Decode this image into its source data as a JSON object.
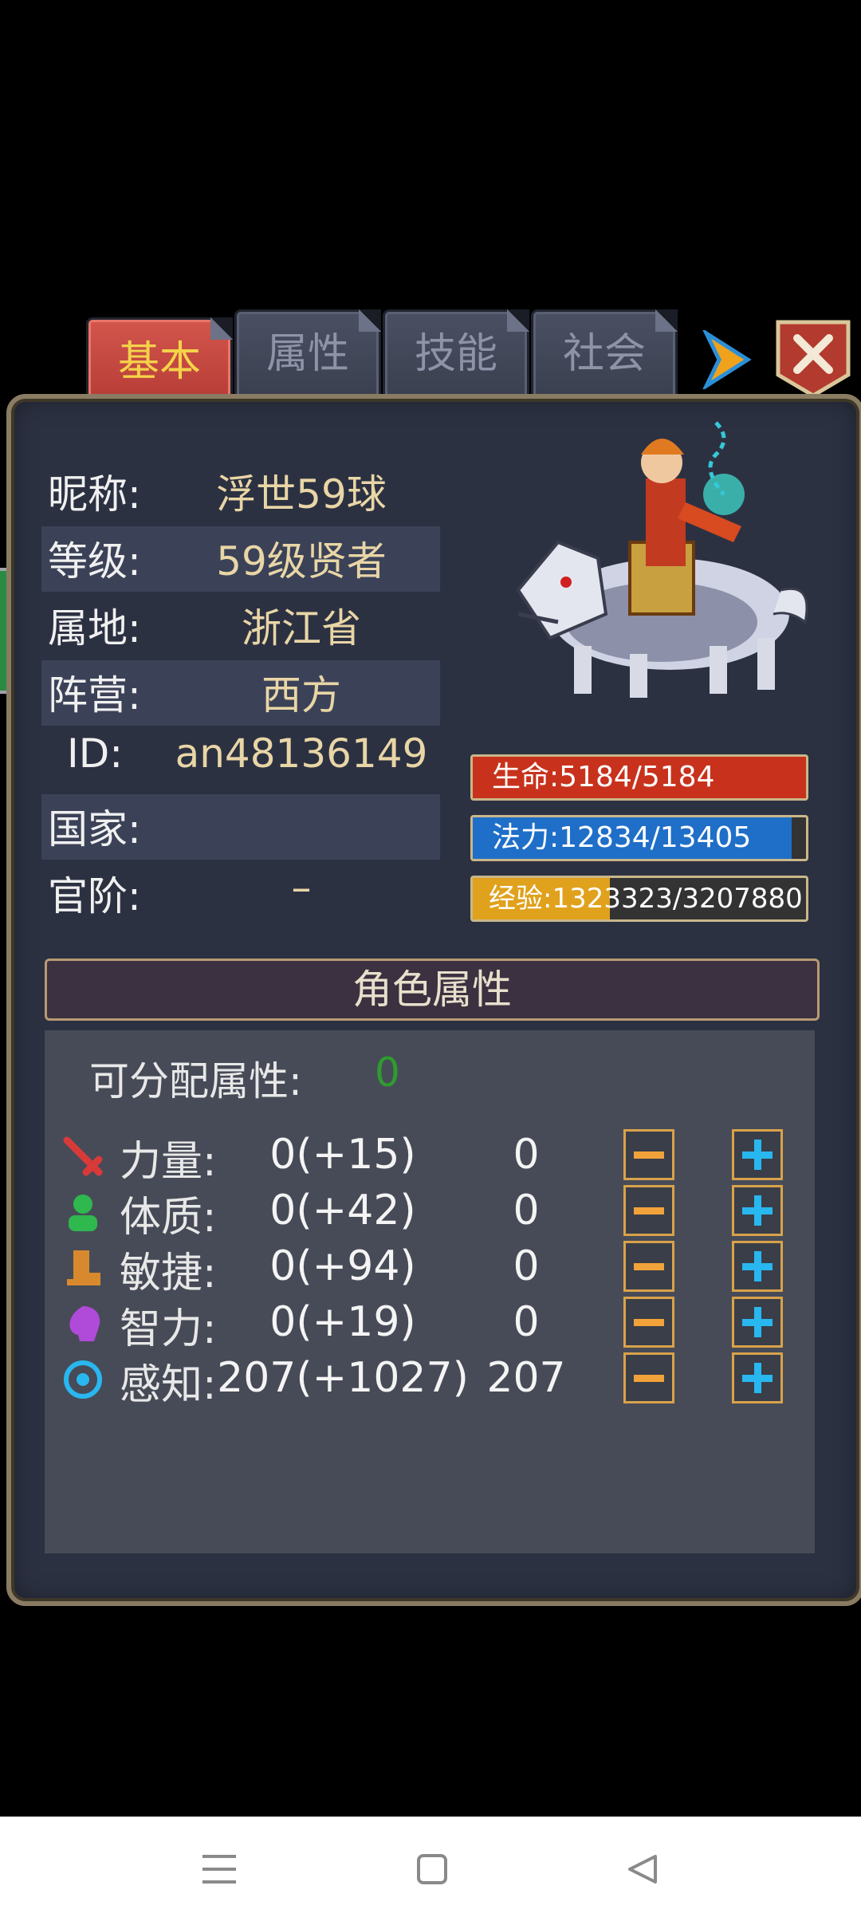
{
  "tabs": [
    {
      "label": "基本",
      "active": true
    },
    {
      "label": "属性",
      "active": false
    },
    {
      "label": "技能",
      "active": false
    },
    {
      "label": "社会",
      "active": false
    }
  ],
  "info": {
    "nickname_label": "昵称:",
    "nickname": "浮世59球",
    "level_label": "等级:",
    "level": "59级贤者",
    "region_label": "属地:",
    "region": "浙江省",
    "camp_label": "阵营:",
    "camp": "西方",
    "id_label": "ID:",
    "id": "an48136149",
    "country_label": "国家:",
    "country": "",
    "rank_label": "官阶:",
    "rank": "–"
  },
  "bars": {
    "hp": {
      "text": "生命:5184/5184",
      "fraction": 1.0,
      "color": "#c8321c"
    },
    "mp": {
      "text": "法力:12834/13405",
      "fraction": 0.957,
      "color": "#1f6fc8"
    },
    "exp": {
      "text": "经验:1323323/3207880",
      "fraction": 0.4125,
      "color": "#e0a11c"
    }
  },
  "attributes": {
    "header": "角色属性",
    "free_label": "可分配属性:",
    "free_value": "0",
    "rows": [
      {
        "icon": "sword-icon",
        "label": "力量:",
        "value": "0(+15)",
        "points": "0"
      },
      {
        "icon": "person-icon",
        "label": "体质:",
        "value": "0(+42)",
        "points": "0"
      },
      {
        "icon": "boot-icon",
        "label": "敏捷:",
        "value": "0(+94)",
        "points": "0"
      },
      {
        "icon": "head-icon",
        "label": "智力:",
        "value": "0(+19)",
        "points": "0"
      },
      {
        "icon": "target-icon",
        "label": "感知:",
        "value": "207(+1027)",
        "points": "207"
      }
    ]
  },
  "colors": {
    "accent_gold": "#e9d6a6",
    "free_points_green": "#2e9c2e",
    "plus_blue": "#29b7f0",
    "minus_orange": "#f2a23a"
  }
}
